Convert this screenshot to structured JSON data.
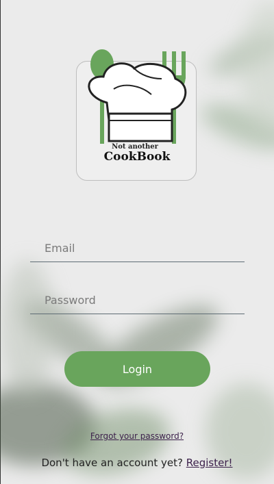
{
  "logo": {
    "line1": "Not another",
    "line2": "CookBook"
  },
  "form": {
    "email_placeholder": "Email",
    "password_placeholder": "Password",
    "login_label": "Login"
  },
  "links": {
    "forgot_password": "Forgot your password?",
    "no_account_prefix": "Don't have an account yet?",
    "register": "Register!"
  },
  "colors": {
    "accent_green": "#69a55c",
    "link_purple": "#3b1f4a",
    "background": "#ebebeb"
  }
}
